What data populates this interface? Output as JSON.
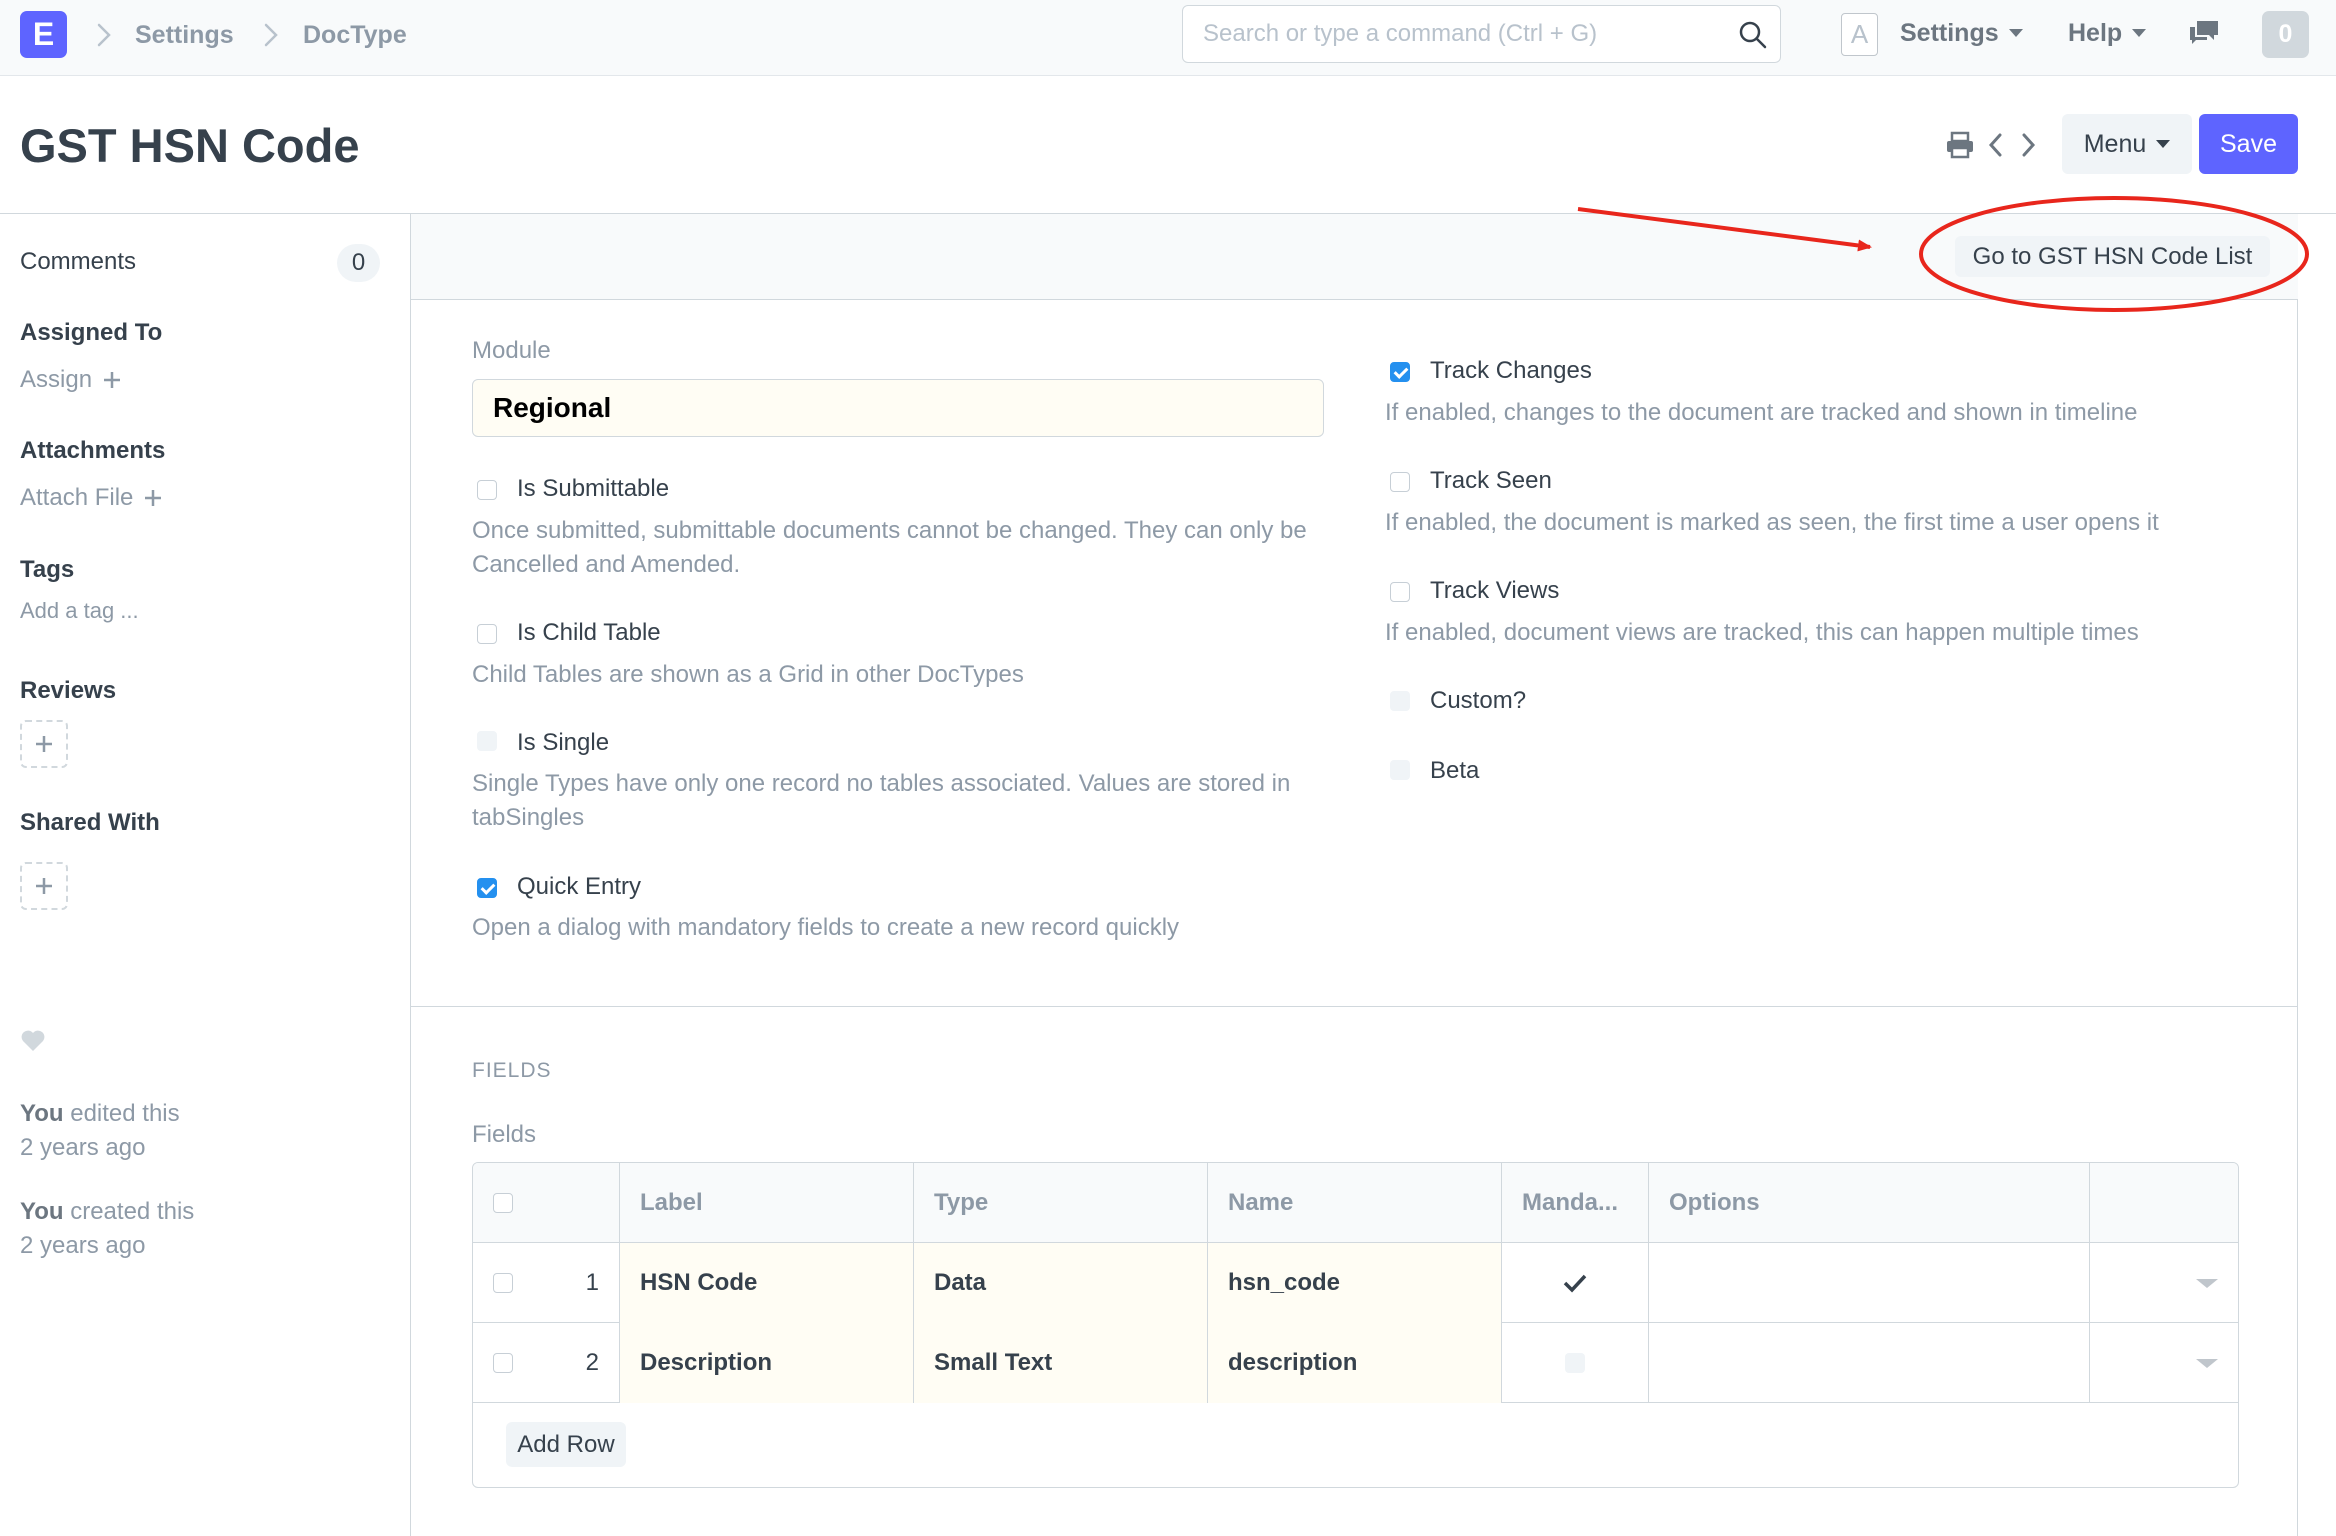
{
  "navbar": {
    "logo_letter": "E",
    "breadcrumbs": [
      "Settings",
      "DocType"
    ],
    "search_placeholder": "Search or type a command (Ctrl + G)",
    "avatar_letter": "A",
    "settings_label": "Settings",
    "help_label": "Help",
    "notification_count": "0"
  },
  "page": {
    "title": "GST HSN Code",
    "menu_label": "Menu",
    "save_label": "Save",
    "accent_color": "#5e64ff"
  },
  "sidebar": {
    "comments_label": "Comments",
    "comments_count": "0",
    "assigned_to_label": "Assigned To",
    "assign_label": "Assign",
    "attachments_label": "Attachments",
    "attach_file_label": "Attach File",
    "tags_label": "Tags",
    "add_tag_label": "Add a tag ...",
    "reviews_label": "Reviews",
    "shared_with_label": "Shared With",
    "timeline": [
      {
        "actor": "You",
        "action": "edited this",
        "when": "2 years ago"
      },
      {
        "actor": "You",
        "action": "created this",
        "when": "2 years ago"
      }
    ]
  },
  "form": {
    "list_button_label": "Go to GST HSN Code List",
    "module_label": "Module",
    "module_value": "Regional",
    "left_checks": [
      {
        "label": "Is Submittable",
        "checked": false,
        "help": "Once submitted, submittable documents cannot be changed. They can only be Cancelled and Amended."
      },
      {
        "label": "Is Child Table",
        "checked": false,
        "help": "Child Tables are shown as a Grid in other DocTypes"
      },
      {
        "label": "Is Single",
        "checked": false,
        "help": "Single Types have only one record no tables associated. Values are stored in tabSingles"
      },
      {
        "label": "Quick Entry",
        "checked": true,
        "help": "Open a dialog with mandatory fields to create a new record quickly"
      }
    ],
    "right_checks": [
      {
        "label": "Track Changes",
        "checked": true,
        "help": "If enabled, changes to the document are tracked and shown in timeline"
      },
      {
        "label": "Track Seen",
        "checked": false,
        "help": "If enabled, the document is marked as seen, the first time a user opens it"
      },
      {
        "label": "Track Views",
        "checked": false,
        "help": "If enabled, document views are tracked, this can happen multiple times"
      },
      {
        "label": "Custom?",
        "checked": false,
        "help": ""
      },
      {
        "label": "Beta",
        "checked": false,
        "help": ""
      }
    ]
  },
  "fields_section": {
    "section_title": "FIELDS",
    "table_label": "Fields",
    "columns": [
      "Label",
      "Type",
      "Name",
      "Manda...",
      "Options"
    ],
    "rows": [
      {
        "idx": "1",
        "label": "HSN Code",
        "type": "Data",
        "name": "hsn_code",
        "mandatory": true,
        "options": ""
      },
      {
        "idx": "2",
        "label": "Description",
        "type": "Small Text",
        "name": "description",
        "mandatory": false,
        "options": ""
      }
    ],
    "add_row_label": "Add Row"
  },
  "annotation": {
    "color": "#e8261c"
  }
}
